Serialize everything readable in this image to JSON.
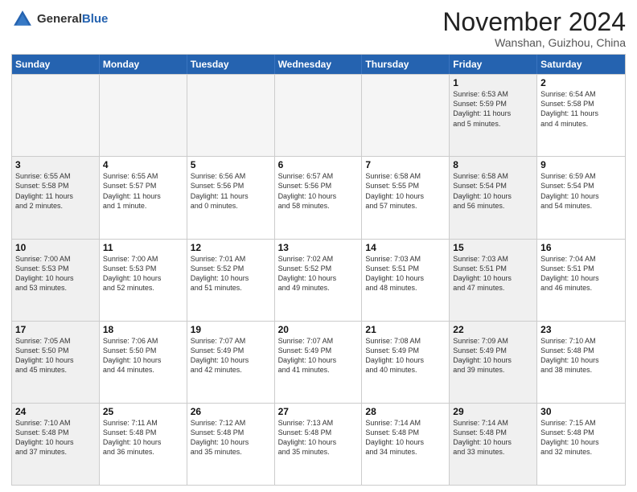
{
  "header": {
    "logo_general": "General",
    "logo_blue": "Blue",
    "month_title": "November 2024",
    "location": "Wanshan, Guizhou, China"
  },
  "calendar": {
    "days_of_week": [
      "Sunday",
      "Monday",
      "Tuesday",
      "Wednesday",
      "Thursday",
      "Friday",
      "Saturday"
    ],
    "rows": [
      [
        {
          "day": "",
          "info": "",
          "empty": true
        },
        {
          "day": "",
          "info": "",
          "empty": true
        },
        {
          "day": "",
          "info": "",
          "empty": true
        },
        {
          "day": "",
          "info": "",
          "empty": true
        },
        {
          "day": "",
          "info": "",
          "empty": true
        },
        {
          "day": "1",
          "info": "Sunrise: 6:53 AM\nSunset: 5:59 PM\nDaylight: 11 hours\nand 5 minutes.",
          "shaded": true
        },
        {
          "day": "2",
          "info": "Sunrise: 6:54 AM\nSunset: 5:58 PM\nDaylight: 11 hours\nand 4 minutes.",
          "shaded": false
        }
      ],
      [
        {
          "day": "3",
          "info": "Sunrise: 6:55 AM\nSunset: 5:58 PM\nDaylight: 11 hours\nand 2 minutes.",
          "shaded": true
        },
        {
          "day": "4",
          "info": "Sunrise: 6:55 AM\nSunset: 5:57 PM\nDaylight: 11 hours\nand 1 minute.",
          "shaded": false
        },
        {
          "day": "5",
          "info": "Sunrise: 6:56 AM\nSunset: 5:56 PM\nDaylight: 11 hours\nand 0 minutes.",
          "shaded": false
        },
        {
          "day": "6",
          "info": "Sunrise: 6:57 AM\nSunset: 5:56 PM\nDaylight: 10 hours\nand 58 minutes.",
          "shaded": false
        },
        {
          "day": "7",
          "info": "Sunrise: 6:58 AM\nSunset: 5:55 PM\nDaylight: 10 hours\nand 57 minutes.",
          "shaded": false
        },
        {
          "day": "8",
          "info": "Sunrise: 6:58 AM\nSunset: 5:54 PM\nDaylight: 10 hours\nand 56 minutes.",
          "shaded": true
        },
        {
          "day": "9",
          "info": "Sunrise: 6:59 AM\nSunset: 5:54 PM\nDaylight: 10 hours\nand 54 minutes.",
          "shaded": false
        }
      ],
      [
        {
          "day": "10",
          "info": "Sunrise: 7:00 AM\nSunset: 5:53 PM\nDaylight: 10 hours\nand 53 minutes.",
          "shaded": true
        },
        {
          "day": "11",
          "info": "Sunrise: 7:00 AM\nSunset: 5:53 PM\nDaylight: 10 hours\nand 52 minutes.",
          "shaded": false
        },
        {
          "day": "12",
          "info": "Sunrise: 7:01 AM\nSunset: 5:52 PM\nDaylight: 10 hours\nand 51 minutes.",
          "shaded": false
        },
        {
          "day": "13",
          "info": "Sunrise: 7:02 AM\nSunset: 5:52 PM\nDaylight: 10 hours\nand 49 minutes.",
          "shaded": false
        },
        {
          "day": "14",
          "info": "Sunrise: 7:03 AM\nSunset: 5:51 PM\nDaylight: 10 hours\nand 48 minutes.",
          "shaded": false
        },
        {
          "day": "15",
          "info": "Sunrise: 7:03 AM\nSunset: 5:51 PM\nDaylight: 10 hours\nand 47 minutes.",
          "shaded": true
        },
        {
          "day": "16",
          "info": "Sunrise: 7:04 AM\nSunset: 5:51 PM\nDaylight: 10 hours\nand 46 minutes.",
          "shaded": false
        }
      ],
      [
        {
          "day": "17",
          "info": "Sunrise: 7:05 AM\nSunset: 5:50 PM\nDaylight: 10 hours\nand 45 minutes.",
          "shaded": true
        },
        {
          "day": "18",
          "info": "Sunrise: 7:06 AM\nSunset: 5:50 PM\nDaylight: 10 hours\nand 44 minutes.",
          "shaded": false
        },
        {
          "day": "19",
          "info": "Sunrise: 7:07 AM\nSunset: 5:49 PM\nDaylight: 10 hours\nand 42 minutes.",
          "shaded": false
        },
        {
          "day": "20",
          "info": "Sunrise: 7:07 AM\nSunset: 5:49 PM\nDaylight: 10 hours\nand 41 minutes.",
          "shaded": false
        },
        {
          "day": "21",
          "info": "Sunrise: 7:08 AM\nSunset: 5:49 PM\nDaylight: 10 hours\nand 40 minutes.",
          "shaded": false
        },
        {
          "day": "22",
          "info": "Sunrise: 7:09 AM\nSunset: 5:49 PM\nDaylight: 10 hours\nand 39 minutes.",
          "shaded": true
        },
        {
          "day": "23",
          "info": "Sunrise: 7:10 AM\nSunset: 5:48 PM\nDaylight: 10 hours\nand 38 minutes.",
          "shaded": false
        }
      ],
      [
        {
          "day": "24",
          "info": "Sunrise: 7:10 AM\nSunset: 5:48 PM\nDaylight: 10 hours\nand 37 minutes.",
          "shaded": true
        },
        {
          "day": "25",
          "info": "Sunrise: 7:11 AM\nSunset: 5:48 PM\nDaylight: 10 hours\nand 36 minutes.",
          "shaded": false
        },
        {
          "day": "26",
          "info": "Sunrise: 7:12 AM\nSunset: 5:48 PM\nDaylight: 10 hours\nand 35 minutes.",
          "shaded": false
        },
        {
          "day": "27",
          "info": "Sunrise: 7:13 AM\nSunset: 5:48 PM\nDaylight: 10 hours\nand 35 minutes.",
          "shaded": false
        },
        {
          "day": "28",
          "info": "Sunrise: 7:14 AM\nSunset: 5:48 PM\nDaylight: 10 hours\nand 34 minutes.",
          "shaded": false
        },
        {
          "day": "29",
          "info": "Sunrise: 7:14 AM\nSunset: 5:48 PM\nDaylight: 10 hours\nand 33 minutes.",
          "shaded": true
        },
        {
          "day": "30",
          "info": "Sunrise: 7:15 AM\nSunset: 5:48 PM\nDaylight: 10 hours\nand 32 minutes.",
          "shaded": false
        }
      ]
    ]
  }
}
